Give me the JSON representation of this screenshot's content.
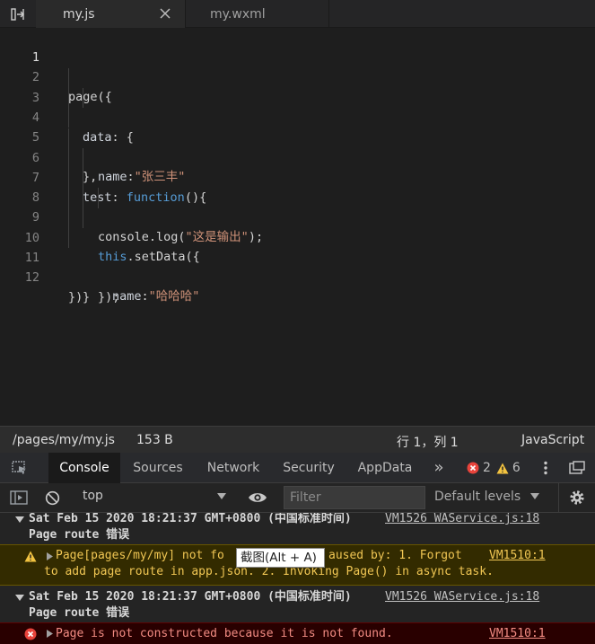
{
  "tabs": [
    {
      "label": "my.js",
      "active": true
    },
    {
      "label": "my.wxml",
      "active": false
    }
  ],
  "editor": {
    "lines": [
      {
        "num": "1",
        "active": true
      },
      {
        "num": "2"
      },
      {
        "num": "3"
      },
      {
        "num": "4"
      },
      {
        "num": "5"
      },
      {
        "num": "6"
      },
      {
        "num": "7"
      },
      {
        "num": "8"
      },
      {
        "num": "9"
      },
      {
        "num": "10"
      },
      {
        "num": "11"
      },
      {
        "num": "12"
      }
    ],
    "code": {
      "l2": "page({",
      "l3_key": "data",
      "l3_rest": ": {",
      "l4_key": "name",
      "l4_colon": ":",
      "l4_str": "\"张三丰\"",
      "l5": "},",
      "l6_key": "test",
      "l6_colon": ": ",
      "l6_kw": "function",
      "l6_rest": "(){",
      "l7_pre": "console.log(",
      "l7_str": "\"这是输出\"",
      "l7_post": ");",
      "l8_kw": "this",
      "l8_rest": ".setData({",
      "l9_key": "name",
      "l9_colon": ":",
      "l9_str": "\"哈哈哈\"",
      "l10": "});",
      "l11": "}",
      "l12": "})"
    }
  },
  "status": {
    "path": "/pages/my/my.js",
    "size": "153 B",
    "position": "行 1，列 1",
    "language": "JavaScript"
  },
  "devtools": {
    "tabs": [
      "Console",
      "Sources",
      "Network",
      "Security",
      "AppData"
    ],
    "active_tab": "Console",
    "more": "»",
    "error_count": "2",
    "warning_count": "6",
    "context": "top",
    "filter_placeholder": "Filter",
    "levels": "Default levels"
  },
  "console": {
    "group1": {
      "timestamp": "Sat Feb 15 2020 18:21:37 GMT+0800 (中国标准时间)",
      "source": "VM1526 WAService.js:18",
      "title": "Page route 错误"
    },
    "warning": {
      "line1_a": "Page[pages/my/my] not fo",
      "line1_b": "aused by: 1. Forgot",
      "source": "VM1510:1",
      "line2": "to add page route in app.json. 2. Invoking Page() in async task."
    },
    "tooltip": "截图(Alt + A)",
    "group2": {
      "timestamp": "Sat Feb 15 2020 18:21:37 GMT+0800 (中国标准时间)",
      "source": "VM1526 WAService.js:18",
      "title": "Page route 错误"
    },
    "error": {
      "message": "Page is not constructed because it is not found.",
      "source": "VM1510:1"
    }
  },
  "colors": {
    "background": "#1e1e1e",
    "warning": "#f0c653",
    "error": "#f28b82",
    "keyword": "#569cd6",
    "string": "#ce9178"
  }
}
